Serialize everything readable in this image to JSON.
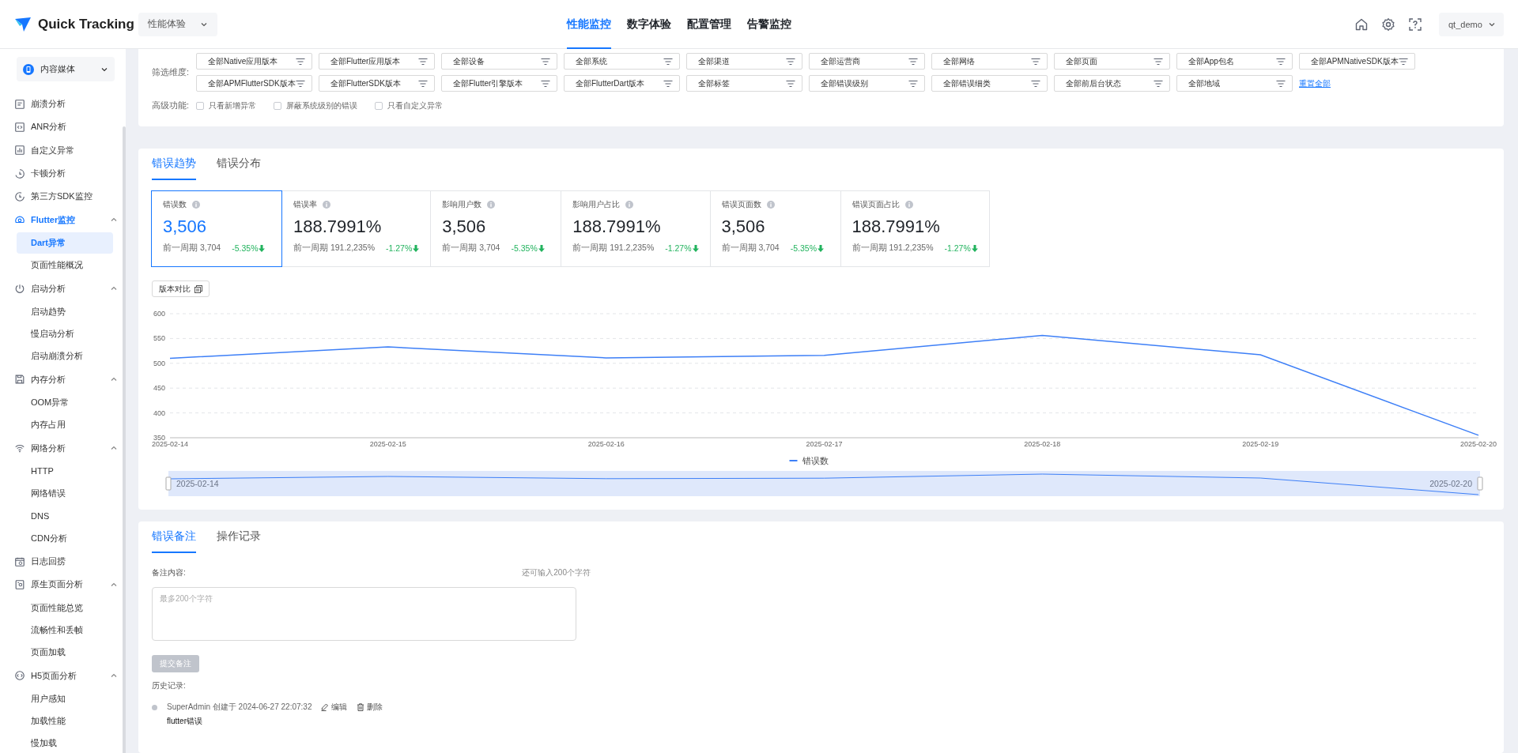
{
  "header": {
    "logo_text": "Quick Tracking",
    "app_select": "性能体验",
    "nav": [
      {
        "label": "性能监控",
        "selected": true
      },
      {
        "label": "数字体验",
        "selected": false
      },
      {
        "label": "配置管理",
        "selected": false
      },
      {
        "label": "告警监控",
        "selected": false
      }
    ],
    "user": "qt_demo"
  },
  "sidebar": {
    "app_select": "内容媒体",
    "items": [
      {
        "kind": "link",
        "label": "崩溃分析",
        "selected": false
      },
      {
        "kind": "link",
        "label": "ANR分析",
        "selected": false
      },
      {
        "kind": "link",
        "label": "自定义异常",
        "selected": false
      },
      {
        "kind": "link",
        "label": "卡顿分析",
        "selected": false
      },
      {
        "kind": "link",
        "label": "第三方SDK监控",
        "selected": false
      },
      {
        "kind": "group",
        "label": "Flutter监控",
        "expanded": true,
        "children": [
          {
            "label": "Dart异常",
            "selected": true
          },
          {
            "label": "页面性能概况",
            "selected": false
          }
        ]
      },
      {
        "kind": "group",
        "label": "启动分析",
        "expanded": true,
        "children": [
          {
            "label": "启动趋势",
            "selected": false
          },
          {
            "label": "慢启动分析",
            "selected": false
          },
          {
            "label": "启动崩溃分析",
            "selected": false
          }
        ]
      },
      {
        "kind": "group",
        "label": "内存分析",
        "expanded": true,
        "children": [
          {
            "label": "OOM异常",
            "selected": false
          },
          {
            "label": "内存占用",
            "selected": false
          }
        ]
      },
      {
        "kind": "group",
        "label": "网络分析",
        "expanded": true,
        "children": [
          {
            "label": "HTTP",
            "selected": false
          },
          {
            "label": "网络错误",
            "selected": false
          },
          {
            "label": "DNS",
            "selected": false
          },
          {
            "label": "CDN分析",
            "selected": false
          }
        ]
      },
      {
        "kind": "link",
        "label": "日志回捞",
        "selected": false
      },
      {
        "kind": "group",
        "label": "原生页面分析",
        "expanded": true,
        "children": [
          {
            "label": "页面性能总览",
            "selected": false
          },
          {
            "label": "流畅性和丢帧",
            "selected": false
          },
          {
            "label": "页面加载",
            "selected": false
          }
        ]
      },
      {
        "kind": "group",
        "label": "H5页面分析",
        "expanded": true,
        "children": [
          {
            "label": "用户感知",
            "selected": false
          },
          {
            "label": "加载性能",
            "selected": false
          },
          {
            "label": "慢加载",
            "selected": false
          }
        ]
      }
    ]
  },
  "filters": {
    "label": "筛选维度:",
    "rows": [
      [
        "全部Native应用版本",
        "全部Flutter应用版本",
        "全部设备",
        "全部系统",
        "全部渠道",
        "全部运营商",
        "全部网络",
        "全部页面",
        "全部App包名",
        "全部APMNativeSDK版本"
      ],
      [
        "全部APMFlutterSDK版本",
        "全部FlutterSDK版本",
        "全部Flutter引擎版本",
        "全部FlutterDart版本",
        "全部标签",
        "全部错误级别",
        "全部错误细类",
        "全部前后台状态",
        "全部地域"
      ]
    ],
    "reset_link": "重置全部",
    "advanced_label": "高级功能:",
    "options": [
      {
        "label": "只看新增异常",
        "checked": false
      },
      {
        "label": "屏蔽系统级别的错误",
        "checked": false
      },
      {
        "label": "只看自定义异常",
        "checked": false
      }
    ]
  },
  "trend": {
    "tabs": [
      {
        "label": "错误趋势",
        "selected": true
      },
      {
        "label": "错误分布",
        "selected": false
      }
    ],
    "metrics": [
      {
        "label": "错误数",
        "value": "3,506",
        "previous": "前一周期 3,704",
        "change": "-5.35%",
        "selected": true
      },
      {
        "label": "错误率",
        "value": "188.7991%",
        "previous": "前一周期 191.2,235%",
        "change": "-1.27%",
        "selected": false
      },
      {
        "label": "影响用户数",
        "value": "3,506",
        "previous": "前一周期 3,704",
        "change": "-5.35%",
        "selected": false
      },
      {
        "label": "影响用户占比",
        "value": "188.7991%",
        "previous": "前一周期 191.2,235%",
        "change": "-1.27%",
        "selected": false
      },
      {
        "label": "错误页面数",
        "value": "3,506",
        "previous": "前一周期 3,704",
        "change": "-5.35%",
        "selected": false
      },
      {
        "label": "错误页面占比",
        "value": "188.7991%",
        "previous": "前一周期 191.2,235%",
        "change": "-1.27%",
        "selected": false
      }
    ],
    "compare_button": "版本对比",
    "chart_data": {
      "type": "line",
      "categories": [
        "2025-02-14",
        "2025-02-15",
        "2025-02-16",
        "2025-02-17",
        "2025-02-18",
        "2025-02-19",
        "2025-02-20"
      ],
      "series": [
        {
          "name": "错误数",
          "color": "#3d7ff7",
          "values": [
            510,
            533,
            511,
            516,
            556,
            517,
            355
          ]
        }
      ],
      "ylim": [
        350,
        600
      ],
      "yticks": [
        350,
        400,
        450,
        500,
        550,
        600
      ],
      "grid": true
    },
    "range_slider": {
      "start_label": "2025-02-14",
      "end_label": "2025-02-20"
    }
  },
  "notes": {
    "tabs": [
      {
        "label": "错误备注",
        "selected": true
      },
      {
        "label": "操作记录",
        "selected": false
      }
    ],
    "content_label": "备注内容:",
    "remaining": "还可输入200个字符",
    "placeholder": "最多200个字符",
    "submit_button": {
      "label": "提交备注",
      "disabled": true
    },
    "history_label": "历史记录:",
    "history": [
      {
        "meta": "SuperAdmin 创建于 2024-06-27 22:07:32",
        "edit": "编辑",
        "delete": "删除",
        "text": "flutter错误"
      }
    ]
  }
}
